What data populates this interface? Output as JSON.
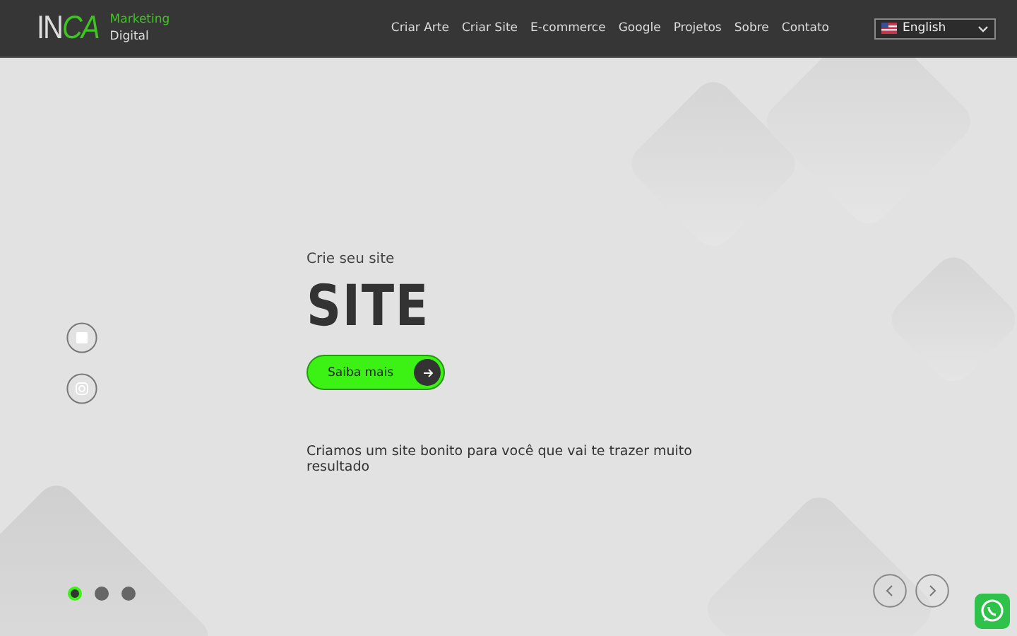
{
  "header": {
    "logo_parts": [
      "IN",
      "CA"
    ],
    "tagline": [
      "Marketing",
      "Digital"
    ],
    "nav": [
      {
        "label": "Criar Arte"
      },
      {
        "label": "Criar Site"
      },
      {
        "label": "E-commerce"
      },
      {
        "label": "Google"
      },
      {
        "label": "Projetos"
      },
      {
        "label": "Sobre"
      },
      {
        "label": "Contato"
      }
    ],
    "language": "English"
  },
  "hero": {
    "subtitle": "Crie seu site",
    "title": "SITE",
    "button": "Saiba mais",
    "description": "Criamos um site bonito para você que vai te trazer muito resultado",
    "slides": [
      {
        "selected": true
      },
      {
        "selected": false
      },
      {
        "selected": false
      }
    ]
  }
}
